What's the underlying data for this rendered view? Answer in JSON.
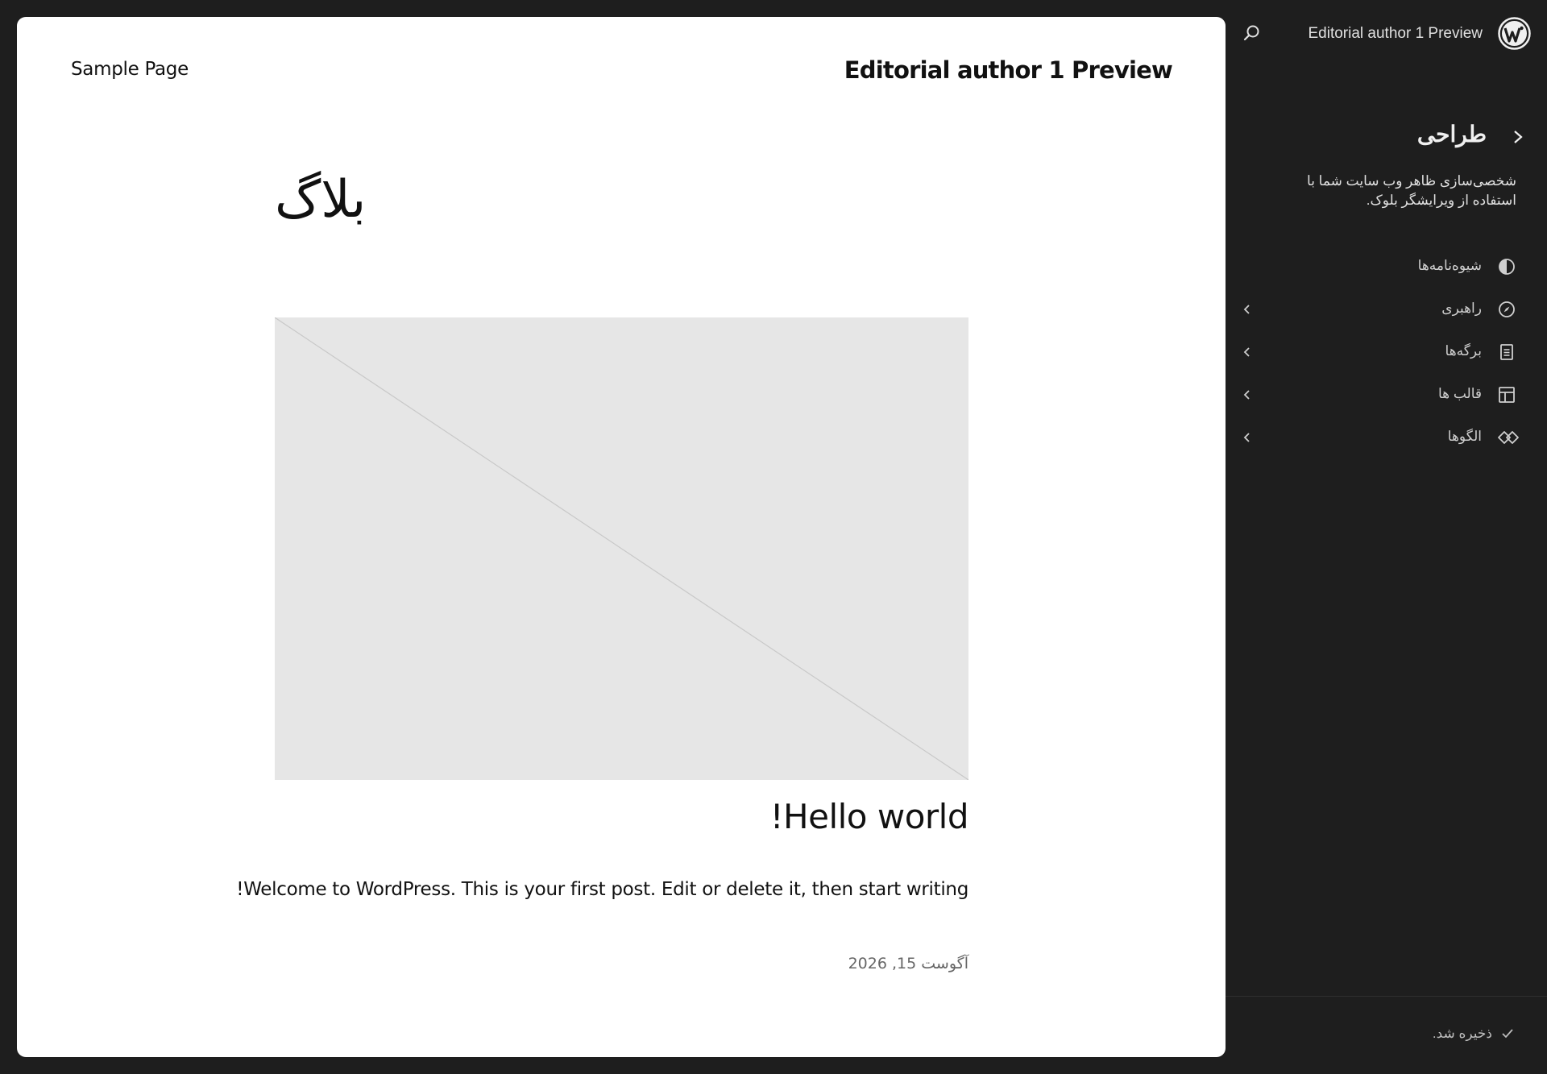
{
  "preview": {
    "nav_link": "Sample Page",
    "site_title": "Editorial author 1 Preview",
    "heading": "بلاگ",
    "post": {
      "title": "Hello world!",
      "excerpt": "Welcome to WordPress. This is your first post. Edit or delete it, then start writing!",
      "date": "آگوست 15, 2026"
    }
  },
  "sidebar": {
    "site_name": "Editorial author 1 Preview",
    "section_title": "طراحی",
    "section_description": "شخصی‌سازی ظاهر وب سایت شما با استفاده از ویرایشگر بلوک.",
    "nav_items": [
      {
        "label": "شیوه‌نامه‌ها",
        "icon": "styles-icon",
        "has_chevron": false
      },
      {
        "label": "راهبری",
        "icon": "navigation-icon",
        "has_chevron": true
      },
      {
        "label": "برگه‌ها",
        "icon": "page-icon",
        "has_chevron": true
      },
      {
        "label": "قالب ها",
        "icon": "layout-icon",
        "has_chevron": true
      },
      {
        "label": "الگوها",
        "icon": "symbol-icon",
        "has_chevron": true
      }
    ],
    "status": "ذخیره شد."
  },
  "colors": {
    "sidebar_bg": "#1e1e1e",
    "canvas_bg": "#ffffff",
    "placeholder_bg": "#e6e6e6"
  }
}
